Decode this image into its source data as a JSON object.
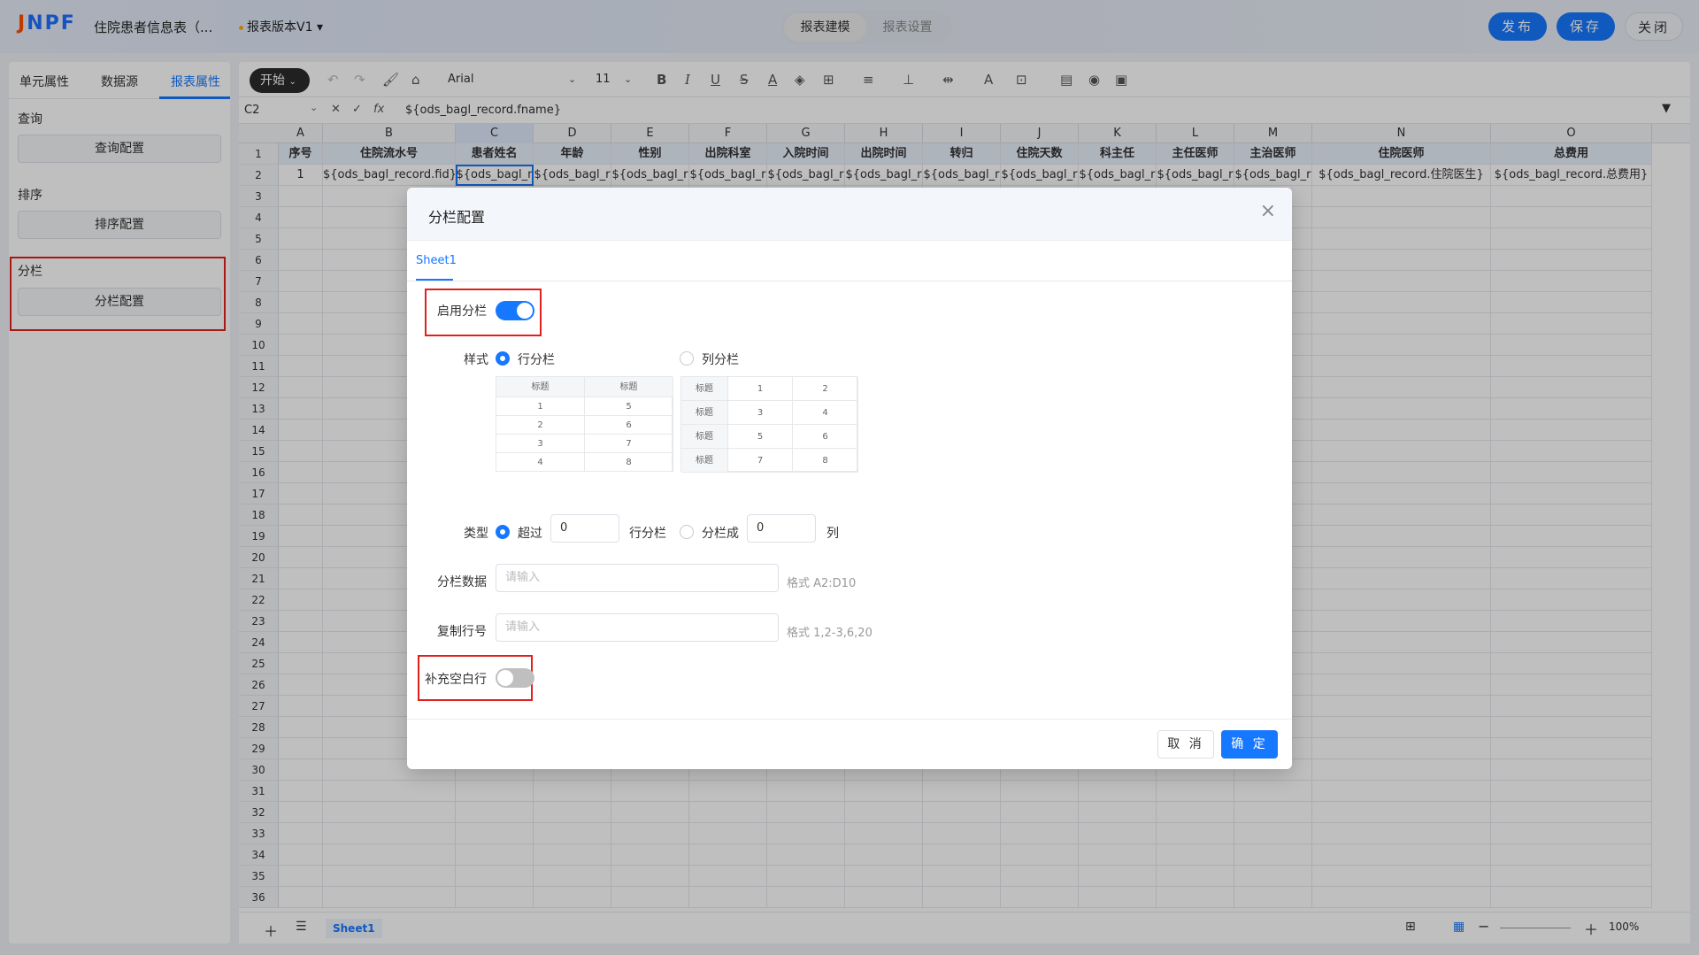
{
  "topbar": {
    "title": "住院患者信息表（...",
    "version": "报表版本V1",
    "tabs": [
      "报表建模",
      "报表设置"
    ],
    "publish": "发布",
    "save": "保存",
    "close": "关闭"
  },
  "left": {
    "tabs": [
      "单元属性",
      "数据源",
      "报表属性"
    ],
    "query_title": "查询",
    "query_btn": "查询配置",
    "sort_title": "排序",
    "sort_btn": "排序配置",
    "column_title": "分栏",
    "column_btn": "分栏配置"
  },
  "toolbar": {
    "start": "开始",
    "font": "Arial",
    "size": "11"
  },
  "formula": {
    "cell": "C2",
    "fx": "fx",
    "value": "${ods_bagl_record.fname}"
  },
  "columns": [
    "A",
    "B",
    "C",
    "D",
    "E",
    "F",
    "G",
    "H",
    "I",
    "J",
    "K",
    "L",
    "M",
    "N",
    "O"
  ],
  "row1": [
    "序号",
    "住院流水号",
    "患者姓名",
    "年龄",
    "性别",
    "出院科室",
    "入院时间",
    "出院时间",
    "转归",
    "住院天数",
    "科主任",
    "主任医师",
    "主治医师",
    "住院医师",
    "总费用"
  ],
  "row2": [
    "1",
    "${ods_bagl_record.fid}",
    "${ods_bagl_r",
    "${ods_bagl_r",
    "${ods_bagl_r",
    "${ods_bagl_r",
    "${ods_bagl_r",
    "${ods_bagl_r",
    "${ods_bagl_r",
    "${ods_bagl_r",
    "${ods_bagl_r",
    "${ods_bagl_r",
    "${ods_bagl_r",
    "${ods_bagl_record.住院医生}",
    "${ods_bagl_record.总费用}"
  ],
  "rows": [
    "1",
    "2",
    "3",
    "4",
    "5",
    "6",
    "7",
    "8",
    "9",
    "10",
    "11",
    "12",
    "13",
    "14",
    "15",
    "16",
    "17",
    "18",
    "19",
    "20",
    "21",
    "22",
    "23",
    "24",
    "25",
    "26",
    "27",
    "28",
    "29",
    "30",
    "31",
    "32",
    "33",
    "34",
    "35",
    "36"
  ],
  "bottom": {
    "sheet": "Sheet1",
    "zoom": "100%"
  },
  "dialog": {
    "title": "分栏配置",
    "tab": "Sheet1",
    "enable_label": "启用分栏",
    "enable_on": true,
    "style_label": "样式",
    "row_col": "行分栏",
    "col_col": "列分栏",
    "preview_row": {
      "head": [
        "标题",
        "标题"
      ],
      "rows": [
        [
          "1",
          "5"
        ],
        [
          "2",
          "6"
        ],
        [
          "3",
          "7"
        ],
        [
          "4",
          "8"
        ]
      ]
    },
    "preview_col": {
      "rows": [
        [
          "标题",
          "1",
          "2"
        ],
        [
          "标题",
          "3",
          "4"
        ],
        [
          "标题",
          "5",
          "6"
        ],
        [
          "标题",
          "7",
          "8"
        ]
      ]
    },
    "type_label": "类型",
    "over": "超过",
    "over_value": "0",
    "row_col_suffix": "行分栏",
    "split_into": "分栏成",
    "split_value": "0",
    "col_suffix": "列",
    "data_label": "分栏数据",
    "data_placeholder": "请输入",
    "data_hint": "格式 A2:D10",
    "copy_label": "复制行号",
    "copy_placeholder": "请输入",
    "copy_hint": "格式 1,2-3,6,20",
    "fill_label": "补充空白行",
    "fill_on": false,
    "cancel": "取 消",
    "ok": "确 定"
  },
  "colors": {
    "accent": "#1677ff",
    "highlight": "#e0201d"
  }
}
